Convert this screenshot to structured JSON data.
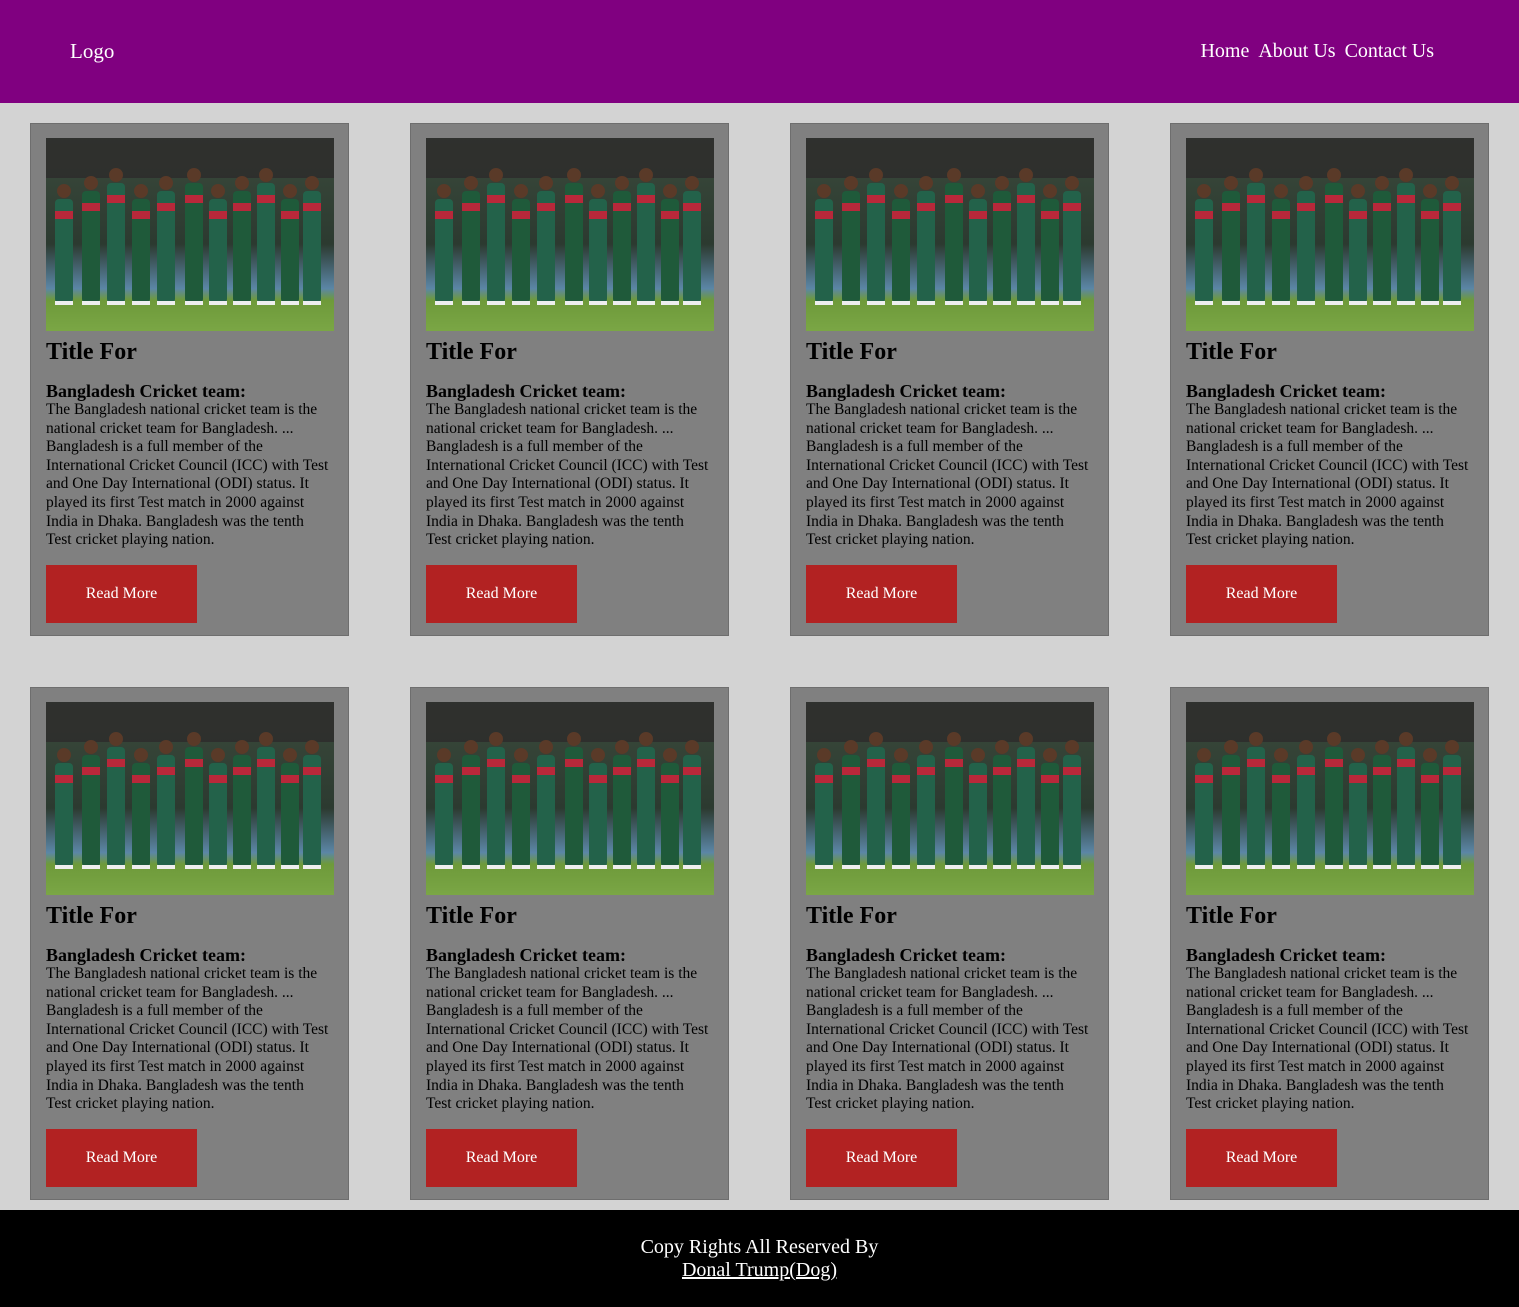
{
  "header": {
    "logo": "Logo",
    "nav": [
      "Home",
      "About Us",
      "Contact Us"
    ]
  },
  "cards": [
    {
      "title": "Title For",
      "subtitle": "Bangladesh Cricket team:",
      "body": "The Bangladesh national cricket team is the national cricket team for Bangladesh. ... Bangladesh is a full member of the International Cricket Council (ICC) with Test and One Day International (ODI) status. It played its first Test match in 2000 against India in Dhaka. Bangladesh was the tenth Test cricket playing nation.",
      "button": "Read More"
    },
    {
      "title": "Title For",
      "subtitle": "Bangladesh Cricket team:",
      "body": "The Bangladesh national cricket team is the national cricket team for Bangladesh. ... Bangladesh is a full member of the International Cricket Council (ICC) with Test and One Day International (ODI) status. It played its first Test match in 2000 against India in Dhaka. Bangladesh was the tenth Test cricket playing nation.",
      "button": "Read More"
    },
    {
      "title": "Title For",
      "subtitle": "Bangladesh Cricket team:",
      "body": "The Bangladesh national cricket team is the national cricket team for Bangladesh. ... Bangladesh is a full member of the International Cricket Council (ICC) with Test and One Day International (ODI) status. It played its first Test match in 2000 against India in Dhaka. Bangladesh was the tenth Test cricket playing nation.",
      "button": "Read More"
    },
    {
      "title": "Title For",
      "subtitle": "Bangladesh Cricket team:",
      "body": "The Bangladesh national cricket team is the national cricket team for Bangladesh. ... Bangladesh is a full member of the International Cricket Council (ICC) with Test and One Day International (ODI) status. It played its first Test match in 2000 against India in Dhaka. Bangladesh was the tenth Test cricket playing nation.",
      "button": "Read More"
    },
    {
      "title": "Title For",
      "subtitle": "Bangladesh Cricket team:",
      "body": "The Bangladesh national cricket team is the national cricket team for Bangladesh. ... Bangladesh is a full member of the International Cricket Council (ICC) with Test and One Day International (ODI) status. It played its first Test match in 2000 against India in Dhaka. Bangladesh was the tenth Test cricket playing nation.",
      "button": "Read More"
    },
    {
      "title": "Title For",
      "subtitle": "Bangladesh Cricket team:",
      "body": "The Bangladesh national cricket team is the national cricket team for Bangladesh. ... Bangladesh is a full member of the International Cricket Council (ICC) with Test and One Day International (ODI) status. It played its first Test match in 2000 against India in Dhaka. Bangladesh was the tenth Test cricket playing nation.",
      "button": "Read More"
    },
    {
      "title": "Title For",
      "subtitle": "Bangladesh Cricket team:",
      "body": "The Bangladesh national cricket team is the national cricket team for Bangladesh. ... Bangladesh is a full member of the International Cricket Council (ICC) with Test and One Day International (ODI) status. It played its first Test match in 2000 against India in Dhaka. Bangladesh was the tenth Test cricket playing nation.",
      "button": "Read More"
    },
    {
      "title": "Title For",
      "subtitle": "Bangladesh Cricket team:",
      "body": "The Bangladesh national cricket team is the national cricket team for Bangladesh. ... Bangladesh is a full member of the International Cricket Council (ICC) with Test and One Day International (ODI) status. It played its first Test match in 2000 against India in Dhaka. Bangladesh was the tenth Test cricket playing nation.",
      "button": "Read More"
    }
  ],
  "footer": {
    "line1": "Copy Rights All Reserved By",
    "link": "Donal Trump(Dog)"
  },
  "colors": {
    "header_bg": "#800080",
    "page_bg": "#d3d3d3",
    "card_bg": "#808080",
    "button_bg": "#b22222",
    "footer_bg": "#000000"
  }
}
